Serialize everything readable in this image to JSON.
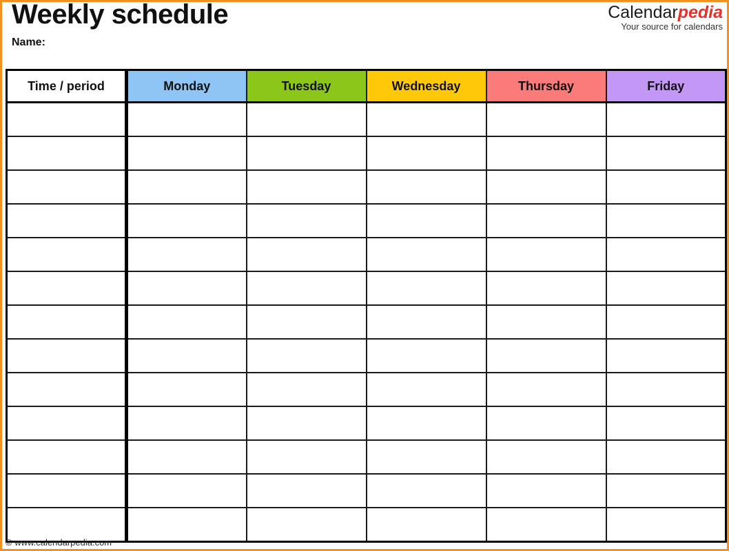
{
  "page": {
    "title": "Weekly schedule",
    "name_label": "Name:",
    "border_color": "#F29020"
  },
  "brand": {
    "part_one": "Calendar",
    "part_two": "pedia",
    "tagline": "Your source for calendars",
    "part_one_color": "#1a1a1a",
    "part_two_color": "#E8312B"
  },
  "table": {
    "columns": [
      {
        "label": "Time / period",
        "bg": "#ffffff",
        "icon": "clock-icon"
      },
      {
        "label": "Monday",
        "bg": "#8EC5F5",
        "icon": "day-icon"
      },
      {
        "label": "Tuesday",
        "bg": "#8CC61A",
        "icon": "day-icon"
      },
      {
        "label": "Wednesday",
        "bg": "#FFC809",
        "icon": "day-icon"
      },
      {
        "label": "Thursday",
        "bg": "#FB7B7B",
        "icon": "day-icon"
      },
      {
        "label": "Friday",
        "bg": "#C297F5",
        "icon": "day-icon"
      }
    ],
    "row_count": 13,
    "rows": [
      {
        "time": "",
        "cells": [
          "",
          "",
          "",
          "",
          ""
        ]
      },
      {
        "time": "",
        "cells": [
          "",
          "",
          "",
          "",
          ""
        ]
      },
      {
        "time": "",
        "cells": [
          "",
          "",
          "",
          "",
          ""
        ]
      },
      {
        "time": "",
        "cells": [
          "",
          "",
          "",
          "",
          ""
        ]
      },
      {
        "time": "",
        "cells": [
          "",
          "",
          "",
          "",
          ""
        ]
      },
      {
        "time": "",
        "cells": [
          "",
          "",
          "",
          "",
          ""
        ]
      },
      {
        "time": "",
        "cells": [
          "",
          "",
          "",
          "",
          ""
        ]
      },
      {
        "time": "",
        "cells": [
          "",
          "",
          "",
          "",
          ""
        ]
      },
      {
        "time": "",
        "cells": [
          "",
          "",
          "",
          "",
          ""
        ]
      },
      {
        "time": "",
        "cells": [
          "",
          "",
          "",
          "",
          ""
        ]
      },
      {
        "time": "",
        "cells": [
          "",
          "",
          "",
          "",
          ""
        ]
      },
      {
        "time": "",
        "cells": [
          "",
          "",
          "",
          "",
          ""
        ]
      },
      {
        "time": "",
        "cells": [
          "",
          "",
          "",
          "",
          ""
        ]
      }
    ]
  },
  "footer": {
    "copyright_symbol": "©",
    "text": "www.calendarpedia.com"
  }
}
